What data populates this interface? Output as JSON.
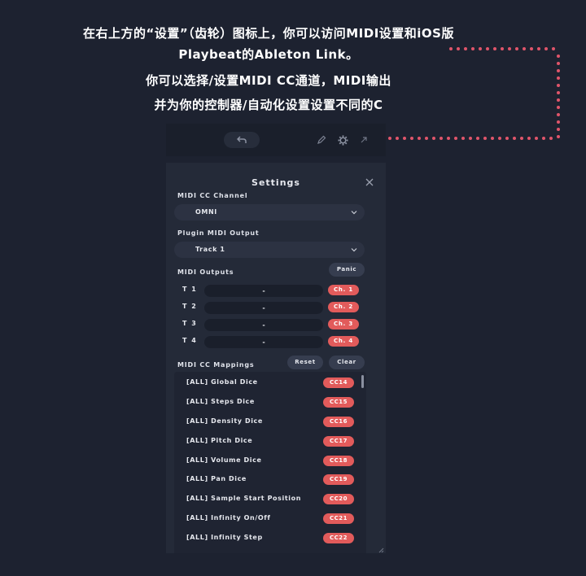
{
  "caption": {
    "line1": "在右上方的“设置”（齿轮）图标上，你可以访问MIDI设置和iOS版",
    "line2": "Playbeat的Ableton Link。",
    "line3": "你可以选择/设置MIDI CC通道，MIDI输出",
    "line4": "并为你的控制器/自动化设置设置不同的C"
  },
  "topbar": {
    "icons": [
      "undo-icon",
      "pencil-icon",
      "gear-icon",
      "expand-icon"
    ]
  },
  "settings": {
    "title": "Settings",
    "midi_cc_channel": {
      "label": "MIDI CC Channel",
      "value": "OMNI"
    },
    "plugin_midi_output": {
      "label": "Plugin MIDI Output",
      "value": "Track 1"
    },
    "midi_outputs": {
      "label": "MIDI Outputs",
      "panic_label": "Panic",
      "tracks": [
        {
          "name": "T 1",
          "value": "-",
          "channel": "Ch. 1"
        },
        {
          "name": "T 2",
          "value": "-",
          "channel": "Ch. 2"
        },
        {
          "name": "T 3",
          "value": "-",
          "channel": "Ch. 3"
        },
        {
          "name": "T 4",
          "value": "-",
          "channel": "Ch. 4"
        }
      ]
    },
    "midi_cc_mappings": {
      "label": "MIDI CC Mappings",
      "reset_label": "Reset",
      "clear_label": "Clear",
      "items": [
        {
          "name": "[ALL] Global Dice",
          "cc": "CC14"
        },
        {
          "name": "[ALL] Steps Dice",
          "cc": "CC15"
        },
        {
          "name": "[ALL] Density Dice",
          "cc": "CC16"
        },
        {
          "name": "[ALL] Pitch Dice",
          "cc": "CC17"
        },
        {
          "name": "[ALL] Volume Dice",
          "cc": "CC18"
        },
        {
          "name": "[ALL] Pan Dice",
          "cc": "CC19"
        },
        {
          "name": "[ALL] Sample Start Position",
          "cc": "CC20"
        },
        {
          "name": "[ALL] Infinity On/Off",
          "cc": "CC21"
        },
        {
          "name": "[ALL] Infinity Step",
          "cc": "CC22"
        }
      ]
    }
  },
  "colors": {
    "background": "#1d2230",
    "panel": "#242a38",
    "accent": "#e25b5b",
    "dots": "#e0556a"
  }
}
